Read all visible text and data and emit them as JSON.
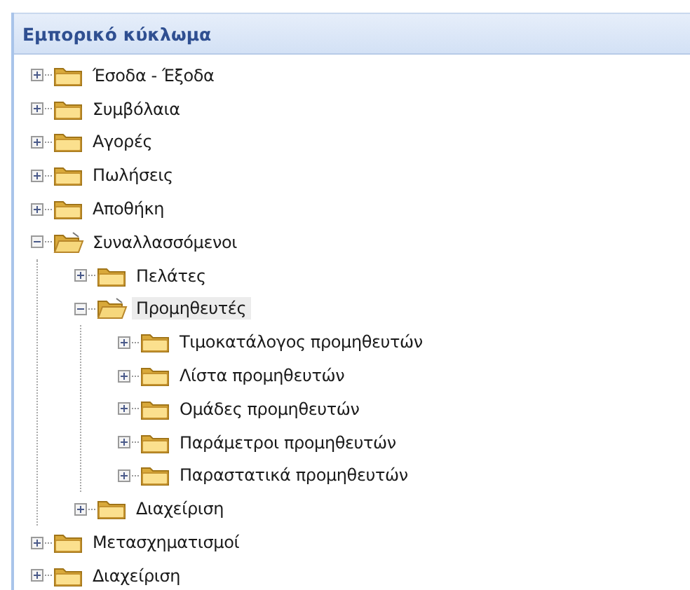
{
  "panel": {
    "title": "Εμπορικό κύκλωμα"
  },
  "tree": [
    {
      "label": "Έσοδα - Έξοδα",
      "expanded": false,
      "selected": false
    },
    {
      "label": "Συμβόλαια",
      "expanded": false,
      "selected": false
    },
    {
      "label": "Αγορές",
      "expanded": false,
      "selected": false
    },
    {
      "label": "Πωλήσεις",
      "expanded": false,
      "selected": false
    },
    {
      "label": "Αποθήκη",
      "expanded": false,
      "selected": false
    },
    {
      "label": "Συναλλασσόμενοι",
      "expanded": true,
      "selected": false,
      "children": [
        {
          "label": "Πελάτες",
          "expanded": false,
          "selected": false
        },
        {
          "label": "Προμηθευτές",
          "expanded": true,
          "selected": true,
          "children": [
            {
              "label": "Τιμοκατάλογος προμηθευτών",
              "expanded": false,
              "selected": false
            },
            {
              "label": "Λίστα προμηθευτών",
              "expanded": false,
              "selected": false
            },
            {
              "label": "Ομάδες προμηθευτών",
              "expanded": false,
              "selected": false
            },
            {
              "label": "Παράμετροι προμηθευτών",
              "expanded": false,
              "selected": false
            },
            {
              "label": "Παραστατικά προμηθευτών",
              "expanded": false,
              "selected": false
            }
          ]
        },
        {
          "label": "Διαχείριση",
          "expanded": false,
          "selected": false
        }
      ]
    },
    {
      "label": "Μετασχηματισμοί",
      "expanded": false,
      "selected": false
    },
    {
      "label": "Διαχείριση",
      "expanded": false,
      "selected": false
    }
  ]
}
